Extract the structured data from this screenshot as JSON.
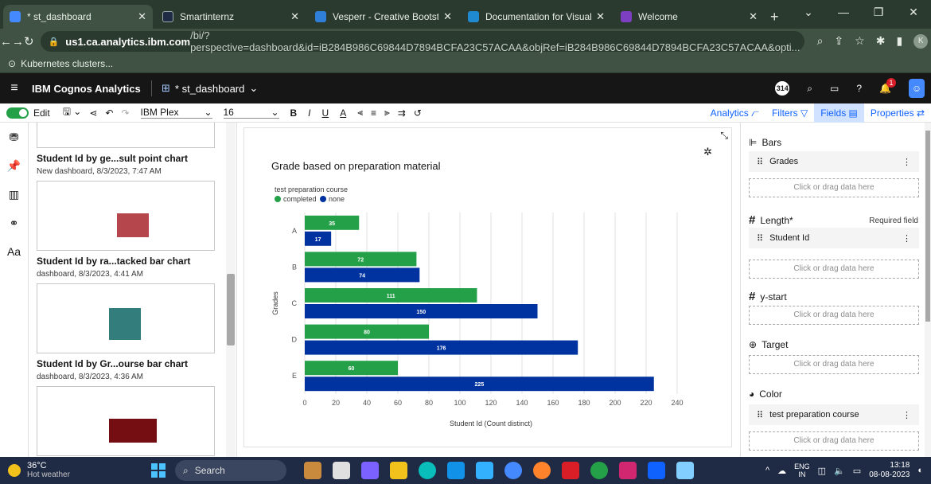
{
  "browser": {
    "tabs": [
      {
        "title": "* st_dashboard",
        "color": "#4589ff"
      },
      {
        "title": "Smartinternz",
        "color": "#1f2a44"
      },
      {
        "title": "Vesperr - Creative Bootstrap",
        "color": "#2f7fd8"
      },
      {
        "title": "Documentation for Visual Stu",
        "color": "#1f8ad2"
      },
      {
        "title": "Welcome",
        "color": "#7d3fc2"
      }
    ],
    "url_domain": "us1.ca.analytics.ibm.com",
    "url_path": "/bi/?perspective=dashboard&id=iB284B986C69844D7894BCFA23C57ACAA&objRef=iB284B986C69844D7894BCFA23C57ACAA&opti...",
    "bookmark": "Kubernetes clusters...",
    "profile_initial": "K"
  },
  "cognos": {
    "brand": "IBM Cognos Analytics",
    "dashboard_name": "* st_dashboard",
    "badge_count": "314",
    "notification_count": "1"
  },
  "toolbar": {
    "edit_label": "Edit",
    "font_family": "IBM Plex",
    "font_size": "16",
    "analytics_label": "Analytics",
    "filters_label": "Filters",
    "fields_label": "Fields",
    "properties_label": "Properties"
  },
  "left_panel": {
    "cards": [
      {
        "title": "Student Id by ge...sult point chart",
        "subtitle": "New dashboard, 8/3/2023, 7:47 AM"
      },
      {
        "title": "Student Id by ra...tacked bar chart",
        "subtitle": "dashboard, 8/3/2023, 4:41 AM"
      },
      {
        "title": "Student Id by Gr...ourse bar chart",
        "subtitle": "dashboard, 8/3/2023, 4:36 AM"
      }
    ]
  },
  "chart_data": {
    "type": "bar",
    "orientation": "horizontal",
    "title": "Grade based on preparation material",
    "legend_title": "test preparation course",
    "categories": [
      "A",
      "B",
      "C",
      "D",
      "E"
    ],
    "series": [
      {
        "name": "completed",
        "color": "#24a148",
        "values": [
          35,
          72,
          111,
          80,
          60
        ]
      },
      {
        "name": "none",
        "color": "#0033a0",
        "values": [
          17,
          74,
          150,
          176,
          225
        ]
      }
    ],
    "xlabel": "Student Id (Count distinct)",
    "ylabel": "Grades",
    "xlim": [
      0,
      240
    ],
    "xticks": [
      0,
      20,
      40,
      60,
      80,
      100,
      120,
      140,
      160,
      180,
      200,
      220,
      240
    ],
    "grid": true,
    "legend_position": "top-left"
  },
  "right_panel": {
    "bars_label": "Bars",
    "bars_field": "Grades",
    "drop_hint": "Click or drag data here",
    "length_label": "Length*",
    "required_label": "Required field",
    "length_field": "Student Id",
    "ystart_label": "y-start",
    "target_label": "Target",
    "color_label": "Color",
    "color_field": "test preparation course"
  },
  "taskbar": {
    "temperature": "36°C",
    "weather": "Hot weather",
    "search": "Search",
    "lang_top": "ENG",
    "lang_bottom": "IN",
    "time": "13:18",
    "date": "08-08-2023"
  }
}
